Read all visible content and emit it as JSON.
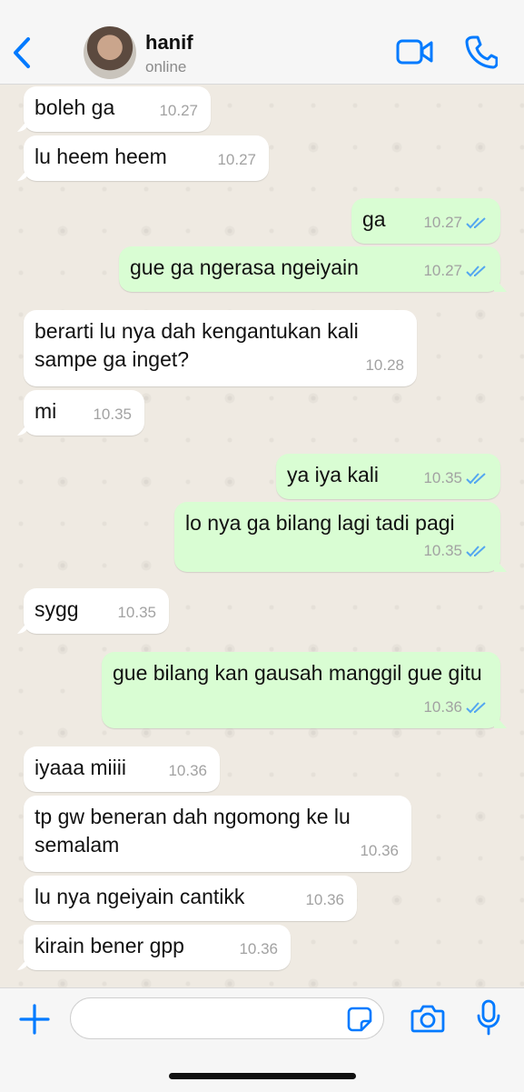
{
  "header": {
    "contact_name": "hanif",
    "status": "online",
    "icons": [
      "chevron-left-icon",
      "video-camera-icon",
      "phone-icon"
    ]
  },
  "messages": [
    {
      "dir": "in",
      "text": "boleh ga",
      "time": "10.27"
    },
    {
      "dir": "in",
      "text": "lu heem heem",
      "time": "10.27"
    },
    {
      "dir": "out",
      "text": "ga",
      "time": "10.27",
      "read": true
    },
    {
      "dir": "out",
      "text": "gue ga ngerasa ngeiyain",
      "time": "10.27",
      "read": true
    },
    {
      "dir": "in",
      "text": "berarti lu nya dah kengantukan kali sampe ga inget?",
      "time": "10.28"
    },
    {
      "dir": "in",
      "text": "mi",
      "time": "10.35"
    },
    {
      "dir": "out",
      "text": "ya iya kali",
      "time": "10.35",
      "read": true
    },
    {
      "dir": "out",
      "text": "lo nya ga bilang lagi tadi pagi",
      "time": "10.35",
      "read": true
    },
    {
      "dir": "in",
      "text": "sygg",
      "time": "10.35"
    },
    {
      "dir": "out",
      "text": "gue bilang kan gausah manggil gue gitu",
      "time": "10.36",
      "read": true
    },
    {
      "dir": "in",
      "text": "iyaaa miiii",
      "time": "10.36"
    },
    {
      "dir": "in",
      "text": "tp gw beneran dah ngomong ke lu semalam",
      "time": "10.36"
    },
    {
      "dir": "in",
      "text": "lu nya ngeiyain cantikk",
      "time": "10.36"
    },
    {
      "dir": "in",
      "text": "kirain bener gpp",
      "time": "10.36"
    }
  ],
  "input_bar": {
    "placeholder": "",
    "icons": [
      "plus-icon",
      "sticker-icon",
      "camera-icon",
      "microphone-icon"
    ]
  },
  "colors": {
    "accent": "#007aff",
    "incoming_bubble": "#ffffff",
    "outgoing_bubble": "#d9fdd3",
    "read_ticks": "#53a6f0",
    "chat_background": "#efeae2"
  }
}
